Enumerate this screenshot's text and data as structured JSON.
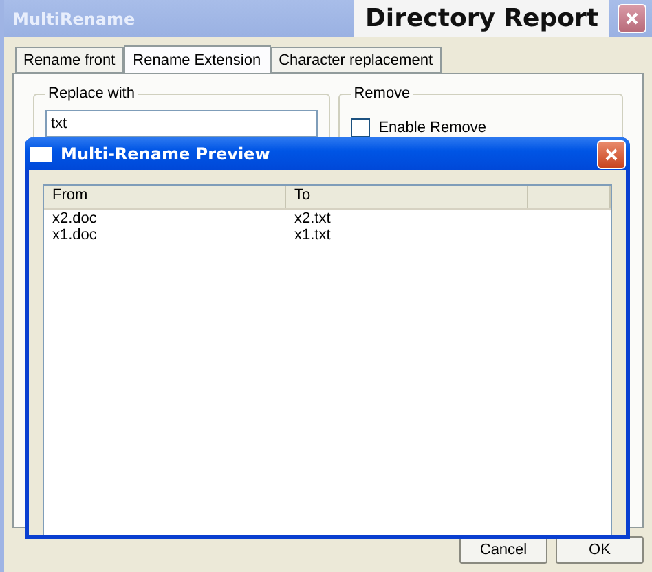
{
  "main_window": {
    "title": "MultiRename",
    "overlay_label": "Directory Report"
  },
  "tabs": [
    {
      "label": "Rename front",
      "selected": false
    },
    {
      "label": "Rename Extension",
      "selected": true
    },
    {
      "label": "Character replacement",
      "selected": false
    }
  ],
  "replace_group": {
    "title": "Replace with",
    "value": "txt"
  },
  "remove_group": {
    "title": "Remove",
    "checkbox": {
      "label": "Enable Remove",
      "checked": false
    }
  },
  "buttons": [
    "Cancel",
    "OK"
  ],
  "preview_dialog": {
    "title": "Multi-Rename Preview",
    "columns": [
      "From",
      "To"
    ],
    "rows": [
      [
        "x2.doc",
        "x2.txt"
      ],
      [
        "x1.doc",
        "x1.txt"
      ]
    ]
  }
}
